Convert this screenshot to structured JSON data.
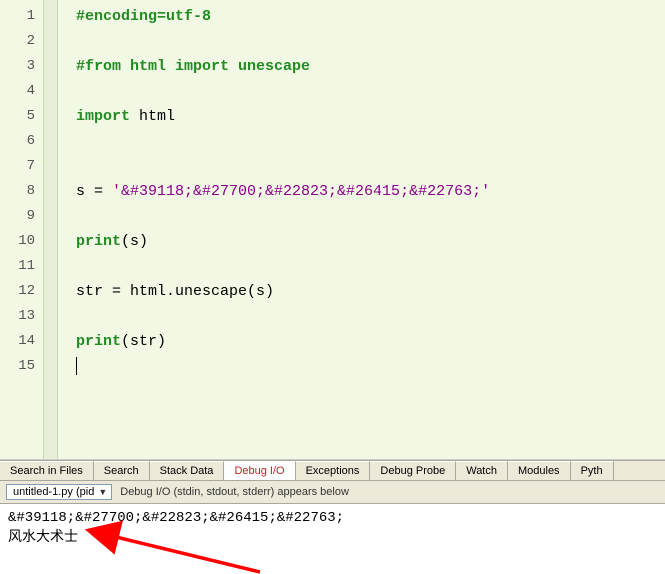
{
  "code": {
    "lines": [
      {
        "n": 1,
        "tokens": [
          {
            "cls": "c-comment",
            "t": "#encoding=utf-8"
          }
        ]
      },
      {
        "n": 2,
        "tokens": []
      },
      {
        "n": 3,
        "tokens": [
          {
            "cls": "c-comment",
            "t": "#from html import unescape"
          }
        ]
      },
      {
        "n": 4,
        "tokens": []
      },
      {
        "n": 5,
        "tokens": [
          {
            "cls": "c-key",
            "t": "import"
          },
          {
            "cls": "c-plain",
            "t": " html"
          }
        ]
      },
      {
        "n": 6,
        "tokens": []
      },
      {
        "n": 7,
        "tokens": []
      },
      {
        "n": 8,
        "tokens": [
          {
            "cls": "c-plain",
            "t": "s = "
          },
          {
            "cls": "c-str",
            "t": "'&#39118;&#27700;&#22823;&#26415;&#22763;'"
          }
        ]
      },
      {
        "n": 9,
        "tokens": []
      },
      {
        "n": 10,
        "tokens": [
          {
            "cls": "c-key",
            "t": "print"
          },
          {
            "cls": "c-plain",
            "t": "(s)"
          }
        ]
      },
      {
        "n": 11,
        "tokens": []
      },
      {
        "n": 12,
        "tokens": [
          {
            "cls": "c-plain",
            "t": "str = html.unescape(s)"
          }
        ]
      },
      {
        "n": 13,
        "tokens": []
      },
      {
        "n": 14,
        "tokens": [
          {
            "cls": "c-key",
            "t": "print"
          },
          {
            "cls": "c-plain",
            "t": "(str)"
          }
        ]
      },
      {
        "n": 15,
        "tokens": [],
        "cursor": true
      }
    ]
  },
  "tabs": {
    "items": [
      {
        "label": "Search in Files",
        "active": false
      },
      {
        "label": "Search",
        "active": false
      },
      {
        "label": "Stack Data",
        "active": false
      },
      {
        "label": "Debug I/O",
        "active": true
      },
      {
        "label": "Exceptions",
        "active": false
      },
      {
        "label": "Debug Probe",
        "active": false
      },
      {
        "label": "Watch",
        "active": false
      },
      {
        "label": "Modules",
        "active": false
      },
      {
        "label": "Pyth",
        "active": false
      }
    ]
  },
  "toolbar": {
    "dropdown_label": "untitled-1.py (pid",
    "hint": "Debug I/O (stdin, stdout, stderr) appears below"
  },
  "output": {
    "line1": "&#39118;&#27700;&#22823;&#26415;&#22763;",
    "line2": "风水大术士"
  },
  "colors": {
    "editor_bg": "#f1f8e3",
    "keyword": "#228b22",
    "string": "#8b008b",
    "arrow": "#ff0000"
  }
}
